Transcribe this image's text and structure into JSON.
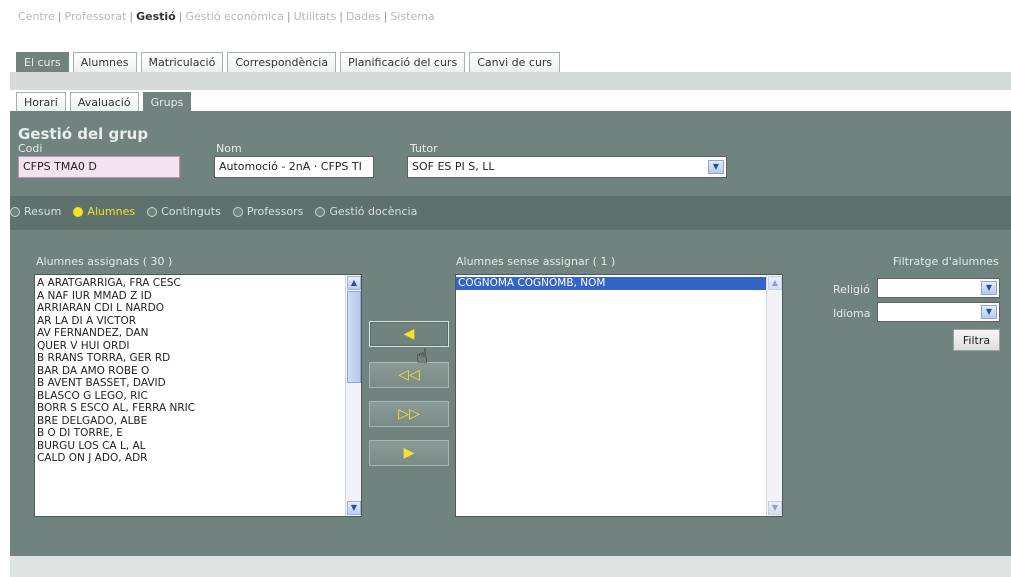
{
  "topnav": {
    "items": [
      "Centre",
      "Professorat",
      "Gestió",
      "Gestió econòmica",
      "Utilitats",
      "Dades",
      "Sistema"
    ],
    "active_index": 2
  },
  "tabs_primary": [
    "El curs",
    "Alumnes",
    "Matriculació",
    "Correspondència",
    "Planificació del curs",
    "Canvi de curs"
  ],
  "tabs_secondary": [
    "Horari",
    "Avaluació",
    "Grups"
  ],
  "header": {
    "title": "Gestió del grup",
    "codi_label": "Codi",
    "codi_value": "CFPS TMA0 D",
    "nom_label": "Nom",
    "nom_value": "Automoció - 2nA · CFPS TI",
    "tutor_label": "Tutor",
    "tutor_value": "SOF    ES PI    S, LL"
  },
  "radios": [
    {
      "label": "Resum",
      "on": false
    },
    {
      "label": "Alumnes",
      "on": true
    },
    {
      "label": "Continguts",
      "on": false
    },
    {
      "label": "Professors",
      "on": false
    },
    {
      "label": "Gestió docència",
      "on": false
    }
  ],
  "assigned": {
    "label": "Alumnes assignats ( 30 )",
    "items": [
      "A  ARATGARRIGA, FRA  CESC",
      "A  NAF   IUR  MMAD Z  ID",
      "ARRIARAN  CDI    L  NARDO",
      "AR  LA     DI  A  VICTOR",
      "AV   FERNANDEZ, DAN",
      "   QUER V  HUI  ORDI",
      "B  RRANS TORRA, GER  RD",
      "BAR  DA AMO  ROBE  O",
      "B  AVENT  BASSET, DAVID",
      "BLASCO G  LEGO,   RIC",
      "BORR  S ESCO  AL, FERRA   NRIC",
      "BRE    DELGADO, ALBE",
      "B  O DI   TORRE, E",
      "BURGU  LOS CA    L, AL",
      "CALD   ON J   ADO, ADR"
    ]
  },
  "unassigned": {
    "label": "Alumnes sense assignar ( 1 )",
    "items": [
      "COGNOMA COGNOMB, NOM"
    ]
  },
  "move_buttons": [
    "◀",
    "◁◁",
    "▷▷",
    "▶"
  ],
  "filter": {
    "title": "Filtratge d'alumnes",
    "religio_label": "Religió",
    "idioma_label": "Idioma",
    "button": "Filtra"
  }
}
